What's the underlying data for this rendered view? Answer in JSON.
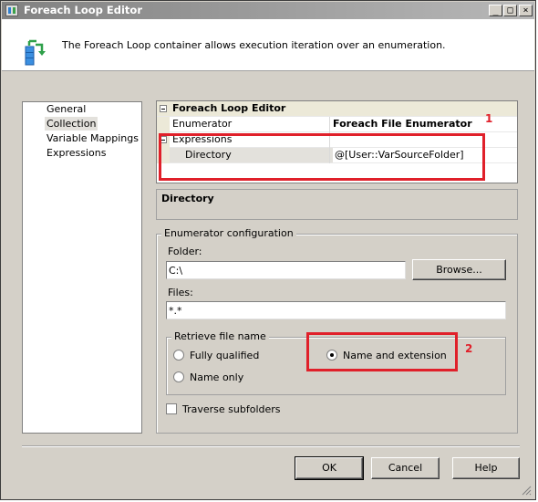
{
  "window": {
    "title": "Foreach Loop Editor",
    "minimize_glyph": "_",
    "maximize_glyph": "□",
    "close_glyph": "×"
  },
  "header": {
    "description": "The Foreach Loop container allows execution iteration over an enumeration."
  },
  "nav": {
    "items": [
      {
        "label": "General",
        "selected": false
      },
      {
        "label": "Collection",
        "selected": true
      },
      {
        "label": "Variable Mappings",
        "selected": false
      },
      {
        "label": "Expressions",
        "selected": false
      }
    ]
  },
  "property_grid": {
    "category": "Foreach Loop Editor",
    "rows": [
      {
        "name": "Enumerator",
        "value": "Foreach File Enumerator"
      },
      {
        "name": "Expressions",
        "value": ""
      },
      {
        "name": "Directory",
        "value": "@[User::VarSourceFolder]"
      }
    ]
  },
  "description_pane": {
    "title": "Directory"
  },
  "enumerator_config": {
    "group_label": "Enumerator configuration",
    "folder_label": "Folder:",
    "folder_value": "C:\\",
    "browse_label": "Browse...",
    "files_label": "Files:",
    "files_value": "*.*",
    "retrieve_group_label": "Retrieve file name",
    "options": [
      {
        "label": "Fully qualified",
        "selected": false
      },
      {
        "label": "Name and extension",
        "selected": true
      },
      {
        "label": "Name only",
        "selected": false
      }
    ],
    "traverse_label": "Traverse subfolders",
    "traverse_checked": false
  },
  "annotations": {
    "one": "1",
    "two": "2",
    "color": "#e0202a"
  },
  "buttons": {
    "ok": "OK",
    "cancel": "Cancel",
    "help": "Help"
  }
}
